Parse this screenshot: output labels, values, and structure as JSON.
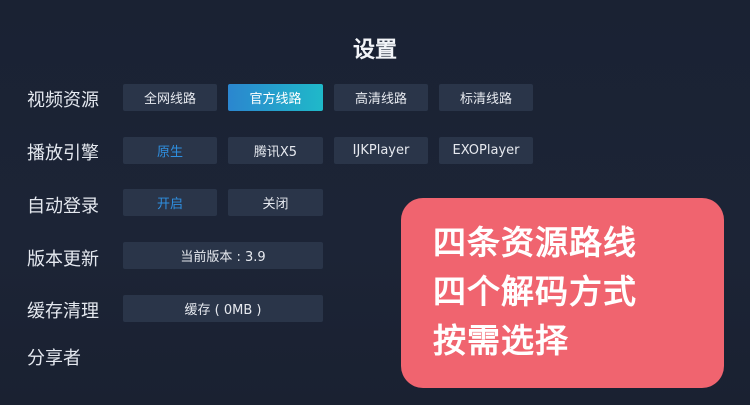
{
  "page": {
    "title": "设置"
  },
  "rows": [
    {
      "label": "视频资源",
      "options": [
        "全网线路",
        "官方线路",
        "高清线路",
        "标清线路"
      ]
    },
    {
      "label": "播放引擎",
      "options": [
        "原生",
        "腾讯X5",
        "IJKPlayer",
        "EXOPlayer"
      ]
    },
    {
      "label": "自动登录",
      "options": [
        "开启",
        "关闭"
      ]
    },
    {
      "label": "版本更新",
      "options": [
        "当前版本 : 3.9"
      ]
    },
    {
      "label": "缓存清理",
      "options": [
        "缓存 ( 0MB )"
      ]
    },
    {
      "label": "分享者"
    }
  ],
  "selected": {
    "video_source": "官方线路",
    "player_engine": "原生",
    "auto_login": "开启"
  },
  "overlay": {
    "lines": [
      "四条资源路线",
      "四个解码方式",
      "按需选择"
    ]
  },
  "colors": {
    "background": "#1b2335",
    "option_bg": "#2a3549",
    "selected_gradient_start": "#2b86cf",
    "selected_gradient_end": "#1fb9c9",
    "selected_text": "#2f8fe0",
    "overlay_bg": "#f0646f"
  }
}
